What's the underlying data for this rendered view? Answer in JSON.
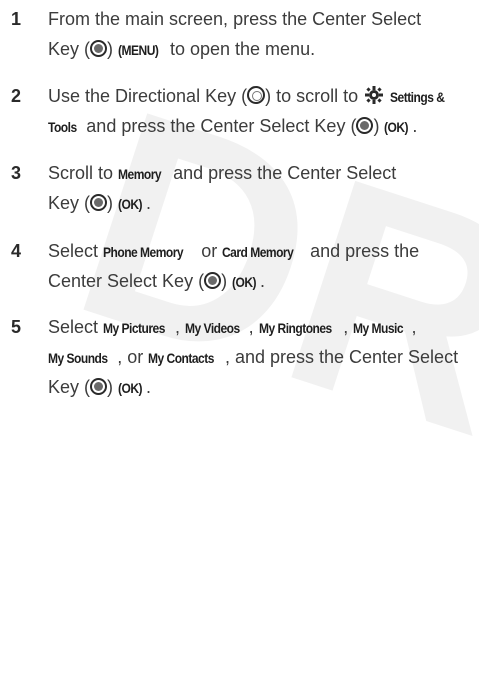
{
  "watermark": "DRAFT",
  "steps": [
    {
      "number": "1",
      "line1_a": "From the main screen, press the Center Select",
      "line2_a": "Key (",
      "line2_b": ") ",
      "line2_kw1": "(MENU)",
      "line2_c": " to open the menu."
    },
    {
      "number": "2",
      "line1_a": "Use the Directional Key (",
      "line1_b": ") to scroll to ",
      "line1_kw1": "Settings &",
      "line2_kw1": "Tools",
      "line2_a": " and press the Center Select Key (",
      "line2_b": ") ",
      "line2_kw2": "(OK)",
      "line2_c": "."
    },
    {
      "number": "3",
      "line1_a": "Scroll to ",
      "line1_kw1": "Memory",
      "line1_b": " and press the Center Select",
      "line2_a": "Key (",
      "line2_b": ") ",
      "line2_kw1": "(OK)",
      "line2_c": "."
    },
    {
      "number": "4",
      "line1_a": "Select ",
      "line1_kw1": "Phone Memory",
      "line1_b": " or ",
      "line1_kw2": "Card Memory",
      "line1_c": " and press the",
      "line2_a": "Center Select Key (",
      "line2_b": ") ",
      "line2_kw1": "(OK)",
      "line2_c": "."
    },
    {
      "number": "5",
      "line1_a": "Select ",
      "line1_kw1": "My Pictures",
      "line1_b": ", ",
      "line1_kw2": "My Videos",
      "line1_c": ", ",
      "line1_kw3": "My Ringtones",
      "line1_d": ", ",
      "line1_kw4": "My Music",
      "line1_e": ",",
      "line2_kw1": "My Sounds",
      "line2_a": ", or ",
      "line2_kw2": "My Contacts",
      "line2_b": ", and press the Center Select",
      "line3_a": "Key (",
      "line3_b": ") ",
      "line3_kw1": "(OK)",
      "line3_c": "."
    }
  ],
  "icons": {
    "center_select": "center-select-key-icon",
    "directional": "directional-key-icon",
    "settings": "settings-gear-icon"
  }
}
